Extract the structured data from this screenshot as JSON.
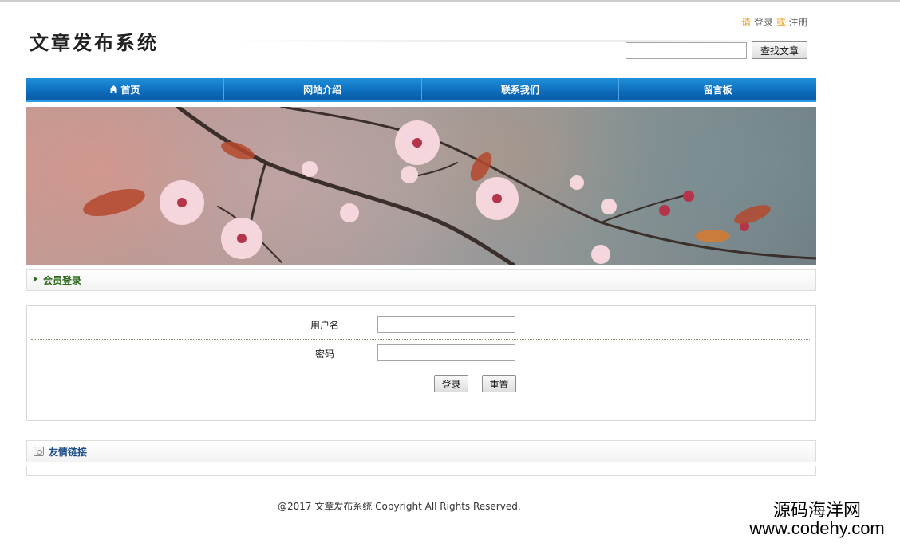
{
  "header": {
    "site_title": "文章发布系统",
    "auth": {
      "prefix": "请",
      "login": "登录",
      "or": "或",
      "register": "注册"
    },
    "search": {
      "placeholder": "",
      "button_label": "查找文章"
    }
  },
  "nav": {
    "items": [
      {
        "label": "首页",
        "icon": "home-icon"
      },
      {
        "label": "网站介绍"
      },
      {
        "label": "联系我们"
      },
      {
        "label": "留言板"
      }
    ]
  },
  "banner": {
    "description_icon": "plum-blossom-image"
  },
  "member_login": {
    "title": "会员登录",
    "username_label": "用户名",
    "username_value": "",
    "password_label": "密码",
    "password_value": "",
    "login_button": "登录",
    "reset_button": "重置"
  },
  "friend_links": {
    "title": "友情链接",
    "icon": "link-icon"
  },
  "footer": {
    "text": "@2017  文章发布系统   Copyright All Rights Reserved."
  },
  "watermark": {
    "line1": "源码海洋网",
    "line2": "www.codehy.com"
  },
  "colors": {
    "nav_blue": "#0d6cbc",
    "login_green": "#2d6b1c",
    "links_blue": "#1c4f8c",
    "accent_orange": "#e8a023"
  }
}
